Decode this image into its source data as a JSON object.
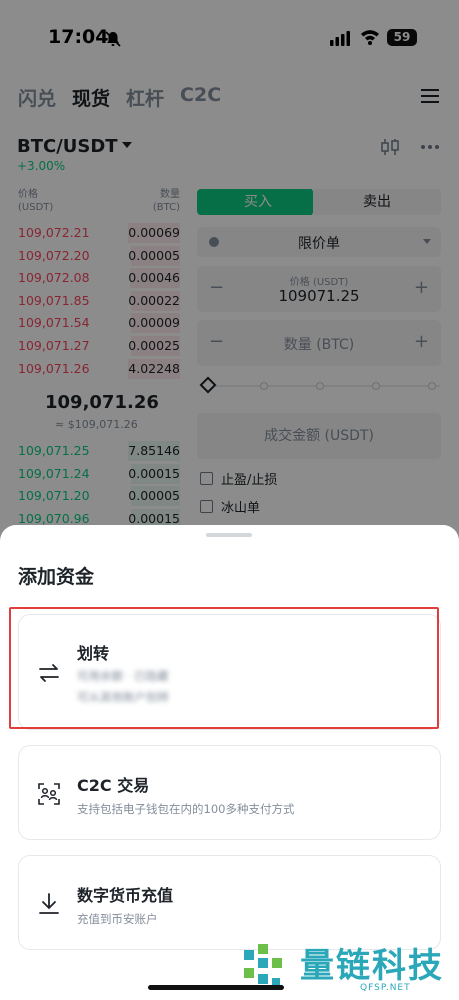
{
  "status": {
    "time": "17:04",
    "battery": "59"
  },
  "top_tabs": [
    {
      "label": "闪兑",
      "active": false
    },
    {
      "label": "现货",
      "active": true
    },
    {
      "label": "杠杆",
      "active": false
    },
    {
      "label": "C2C",
      "active": false
    }
  ],
  "pair": {
    "symbol": "BTC/USDT",
    "change": "+3.00%"
  },
  "orderbook": {
    "price_header": "价格",
    "price_unit": "(USDT)",
    "qty_header": "数量",
    "qty_unit": "(BTC)",
    "asks": [
      {
        "price": "109,072.21",
        "qty": "0.00069",
        "depth": 0.32
      },
      {
        "price": "109,072.20",
        "qty": "0.00005",
        "depth": 0.3
      },
      {
        "price": "109,072.08",
        "qty": "0.00046",
        "depth": 0.31
      },
      {
        "price": "109,071.85",
        "qty": "0.00022",
        "depth": 0.3
      },
      {
        "price": "109,071.54",
        "qty": "0.00009",
        "depth": 0.3
      },
      {
        "price": "109,071.27",
        "qty": "0.00025",
        "depth": 0.3
      },
      {
        "price": "109,071.26",
        "qty": "4.02248",
        "depth": 0.32
      }
    ],
    "mid_price": "109,071.26",
    "mid_fiat": "≈ $109,071.26",
    "bids": [
      {
        "price": "109,071.25",
        "qty": "7.85146",
        "depth": 0.32
      },
      {
        "price": "109,071.24",
        "qty": "0.00015",
        "depth": 0.3
      },
      {
        "price": "109,071.20",
        "qty": "0.00005",
        "depth": 0.3
      },
      {
        "price": "109,070.96",
        "qty": "0.00015",
        "depth": 0.3
      }
    ]
  },
  "order_form": {
    "buy_label": "买入",
    "sell_label": "卖出",
    "order_type": "限价单",
    "price_label": "价格 (USDT)",
    "price_value": "109071.25",
    "qty_placeholder": "数量 (BTC)",
    "amount_placeholder": "成交金额 (USDT)",
    "tpsl_label": "止盈/止损",
    "iceberg_label": "冰山单",
    "minus": "−",
    "plus": "+"
  },
  "sheet": {
    "title": "添加资金",
    "options": [
      {
        "title": "划转",
        "subtitle": "可用余额 · 已隐藏",
        "subtitle2": "可从其他账户划转",
        "icon": "transfer-icon"
      },
      {
        "title": "C2C 交易",
        "subtitle": "支持包括电子钱包在内的100多种支付方式",
        "icon": "c2c-icon"
      },
      {
        "title": "数字货币充值",
        "subtitle": "充值到币安账户",
        "icon": "deposit-icon"
      }
    ]
  },
  "watermark": {
    "text": "量链科技",
    "sub": "QFSP.NET"
  },
  "colors": {
    "up": "#0ecb81",
    "down": "#f6465d",
    "highlight": "#e23d3d",
    "watermark": "#2aa7b8"
  }
}
